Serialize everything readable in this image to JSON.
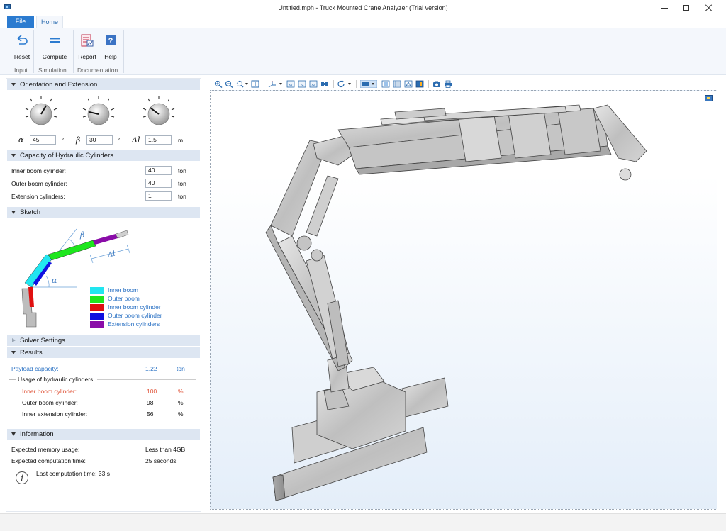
{
  "window": {
    "title": "Untitled.mph - Truck Mounted Crane Analyzer (Trial version)"
  },
  "ribbon": {
    "tabs": {
      "file": "File",
      "home": "Home"
    },
    "buttons": {
      "reset": "Reset",
      "compute": "Compute",
      "report": "Report",
      "help": "Help"
    },
    "groups": {
      "input": "Input",
      "simulation": "Simulation",
      "documentation": "Documentation"
    }
  },
  "orientation": {
    "header": "Orientation and Extension",
    "alpha": {
      "symbol": "α",
      "value": "45",
      "unit": "°"
    },
    "beta": {
      "symbol": "β",
      "value": "30",
      "unit": "°"
    },
    "delta": {
      "symbol": "Δl",
      "value": "1.5",
      "unit": "m"
    }
  },
  "capacity": {
    "header": "Capacity of Hydraulic Cylinders",
    "rows": [
      {
        "label": "Inner boom cylinder:",
        "value": "40",
        "unit": "ton"
      },
      {
        "label": "Outer boom cylinder:",
        "value": "40",
        "unit": "ton"
      },
      {
        "label": "Extension cylinders:",
        "value": "1",
        "unit": "ton"
      }
    ]
  },
  "sketch": {
    "header": "Sketch",
    "labels": {
      "beta": "β",
      "alpha": "α",
      "delta": "Δl"
    },
    "legend": [
      {
        "label": "Inner boom",
        "color": "#21e6f0"
      },
      {
        "label": "Outer boom",
        "color": "#1ee61e"
      },
      {
        "label": "Inner boom cylinder",
        "color": "#e01010"
      },
      {
        "label": "Outer boom cylinder",
        "color": "#1010e0"
      },
      {
        "label": "Extension cylinders",
        "color": "#8a0ca8"
      }
    ]
  },
  "solver": {
    "header": "Solver Settings"
  },
  "results": {
    "header": "Results",
    "payload": {
      "label": "Payload capacity:",
      "value": "1.22",
      "unit": "ton"
    },
    "usage_title": "Usage of hydraulic cylinders",
    "usage": [
      {
        "label": "Inner boom cylinder:",
        "value": "100",
        "unit": "%"
      },
      {
        "label": "Outer boom cylinder:",
        "value": "98",
        "unit": "%"
      },
      {
        "label": "Inner extension cylinder:",
        "value": "56",
        "unit": "%"
      }
    ]
  },
  "information": {
    "header": "Information",
    "rows": [
      {
        "label": "Expected memory usage:",
        "value": "Less than 4GB"
      },
      {
        "label": "Expected computation time:",
        "value": "25 seconds"
      }
    ],
    "last_time": "Last computation time: 33 s"
  },
  "colors": {
    "accent": "#2b7bd0",
    "link_blue": "#2b72c4",
    "warning_red": "#e0553a",
    "header_bg": "#dde6f2"
  }
}
